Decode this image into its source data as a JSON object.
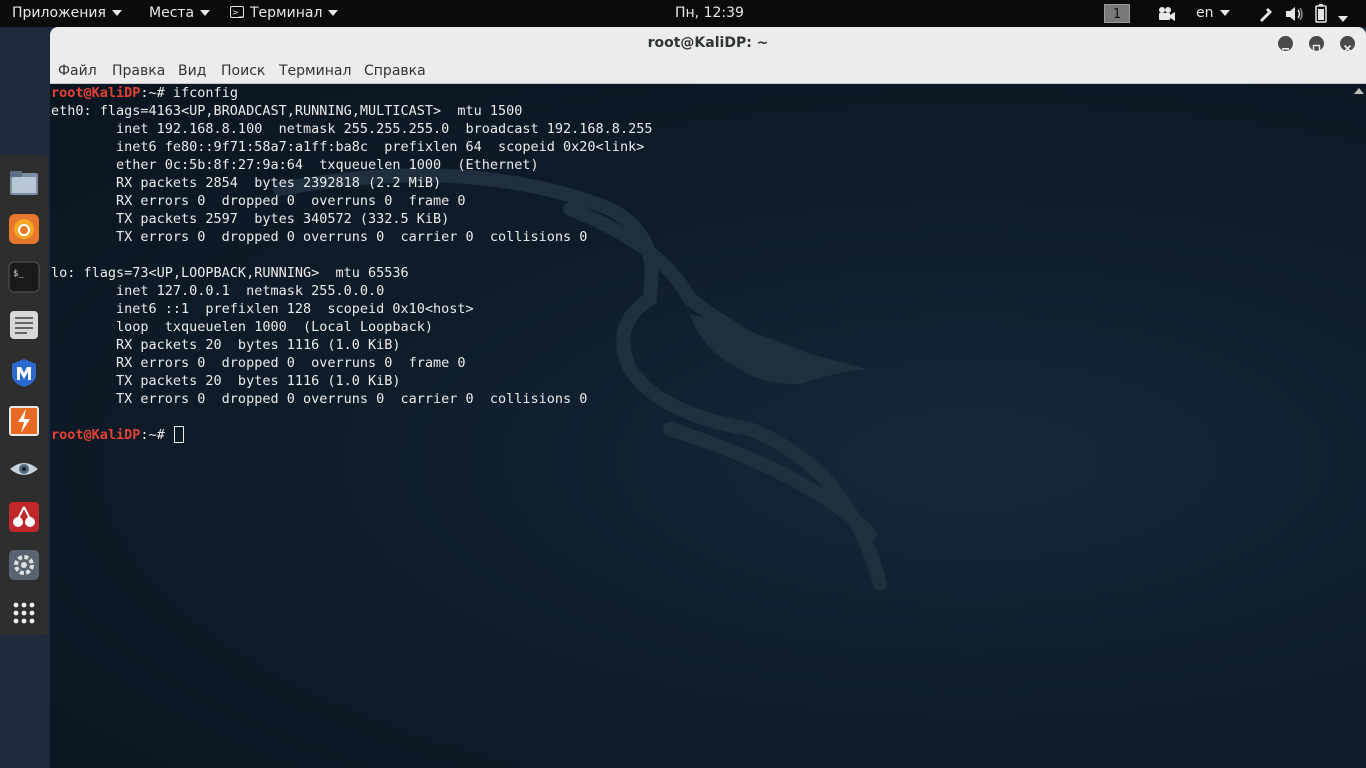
{
  "topbar": {
    "applications": "Приложения",
    "places": "Места",
    "terminal_app": "Терминал",
    "clock": "Пн, 12:39",
    "workspace": "1",
    "keyboard_layout": "en"
  },
  "dock": {
    "items": [
      "files-icon",
      "firefox-icon",
      "terminal-icon",
      "notes-icon",
      "metasploit-icon",
      "burpsuite-icon",
      "eye-icon",
      "cherrytree-icon",
      "settings-icon",
      "app-grid-icon"
    ]
  },
  "window": {
    "title": "root@KaliDP: ~",
    "menu": [
      "Файл",
      "Правка",
      "Вид",
      "Поиск",
      "Терминал",
      "Справка"
    ]
  },
  "terminal": {
    "prompt_user": "root@KaliDP",
    "prompt_path": ":~# ",
    "command": "ifconfig",
    "output": [
      "eth0: flags=4163<UP,BROADCAST,RUNNING,MULTICAST>  mtu 1500",
      "        inet 192.168.8.100  netmask 255.255.255.0  broadcast 192.168.8.255",
      "        inet6 fe80::9f71:58a7:a1ff:ba8c  prefixlen 64  scopeid 0x20<link>",
      "        ether 0c:5b:8f:27:9a:64  txqueuelen 1000  (Ethernet)",
      "        RX packets 2854  bytes 2392818 (2.2 MiB)",
      "        RX errors 0  dropped 0  overruns 0  frame 0",
      "        TX packets 2597  bytes 340572 (332.5 KiB)",
      "        TX errors 0  dropped 0 overruns 0  carrier 0  collisions 0",
      "",
      "lo: flags=73<UP,LOOPBACK,RUNNING>  mtu 65536",
      "        inet 127.0.0.1  netmask 255.0.0.0",
      "        inet6 ::1  prefixlen 128  scopeid 0x10<host>",
      "        loop  txqueuelen 1000  (Local Loopback)",
      "        RX packets 20  bytes 1116 (1.0 KiB)",
      "        RX errors 0  dropped 0  overruns 0  frame 0",
      "        TX packets 20  bytes 1116 (1.0 KiB)",
      "        TX errors 0  dropped 0 overruns 0  carrier 0  collisions 0",
      ""
    ]
  }
}
